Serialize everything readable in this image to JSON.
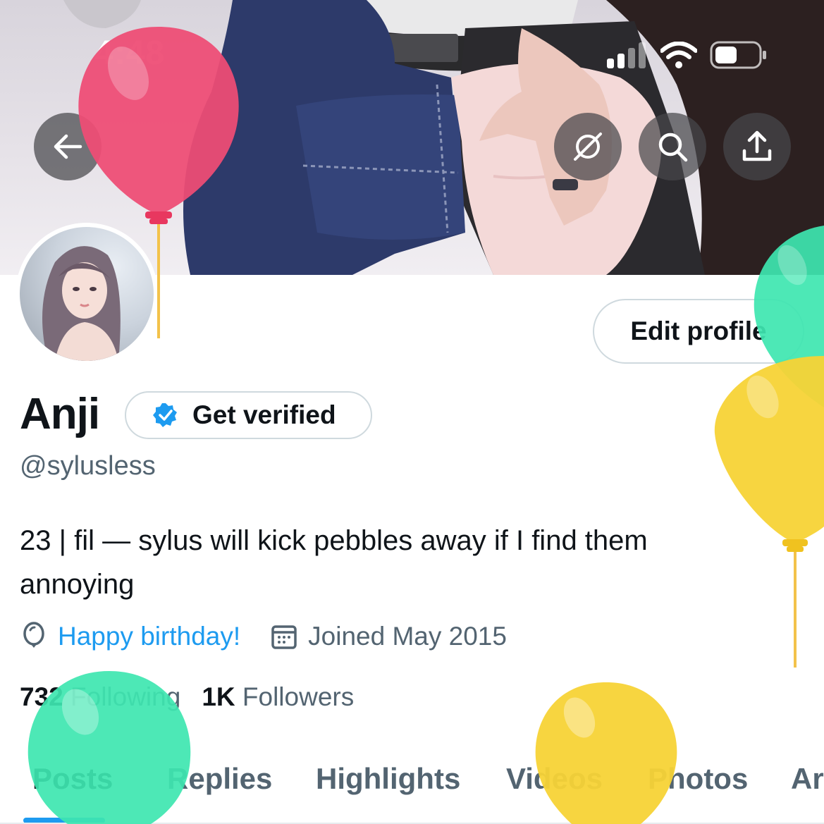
{
  "status_bar": {
    "time": "4:48"
  },
  "header": {
    "back_icon": "arrow-left-icon",
    "action_icons": [
      "grok-icon",
      "search-icon",
      "share-icon"
    ]
  },
  "profile": {
    "edit_label": "Edit profile",
    "name": "Anji",
    "verify_label": "Get verified",
    "handle": "@sylusless",
    "bio": "23 | fil — sylus will kick pebbles away if I find them annoying",
    "birthday_label": "Happy birthday!",
    "joined_label": "Joined May 2015",
    "following_count": "732",
    "following_label": "Following",
    "followers_count": "1K",
    "followers_label": "Followers"
  },
  "tabs": [
    {
      "label": "Posts"
    },
    {
      "label": "Replies"
    },
    {
      "label": "Highlights"
    },
    {
      "label": "Videos"
    },
    {
      "label": "Photos"
    },
    {
      "label": "Ar"
    }
  ],
  "colors": {
    "accent": "#1d9bf0",
    "balloon_pink": "#ee4c75",
    "balloon_green": "#3ee6b0",
    "balloon_yellow": "#f7d336"
  }
}
